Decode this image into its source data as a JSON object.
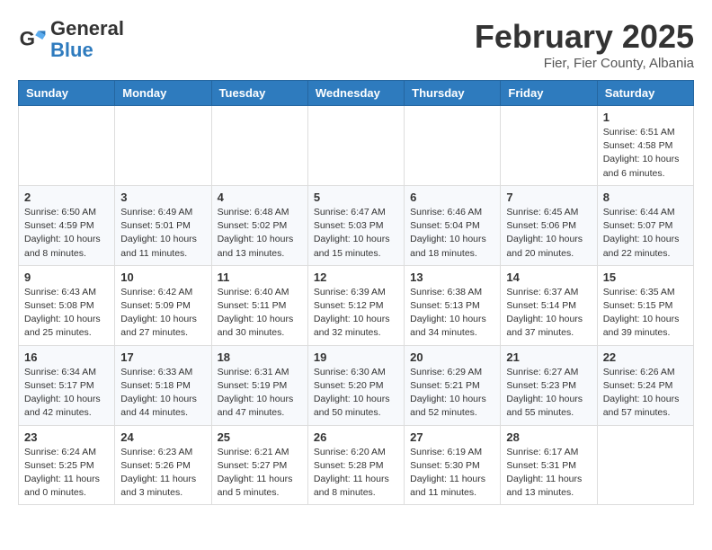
{
  "header": {
    "logo_general": "General",
    "logo_blue": "Blue",
    "month_year": "February 2025",
    "location": "Fier, Fier County, Albania"
  },
  "weekdays": [
    "Sunday",
    "Monday",
    "Tuesday",
    "Wednesday",
    "Thursday",
    "Friday",
    "Saturday"
  ],
  "weeks": [
    [
      {
        "day": "",
        "info": ""
      },
      {
        "day": "",
        "info": ""
      },
      {
        "day": "",
        "info": ""
      },
      {
        "day": "",
        "info": ""
      },
      {
        "day": "",
        "info": ""
      },
      {
        "day": "",
        "info": ""
      },
      {
        "day": "1",
        "info": "Sunrise: 6:51 AM\nSunset: 4:58 PM\nDaylight: 10 hours\nand 6 minutes."
      }
    ],
    [
      {
        "day": "2",
        "info": "Sunrise: 6:50 AM\nSunset: 4:59 PM\nDaylight: 10 hours\nand 8 minutes."
      },
      {
        "day": "3",
        "info": "Sunrise: 6:49 AM\nSunset: 5:01 PM\nDaylight: 10 hours\nand 11 minutes."
      },
      {
        "day": "4",
        "info": "Sunrise: 6:48 AM\nSunset: 5:02 PM\nDaylight: 10 hours\nand 13 minutes."
      },
      {
        "day": "5",
        "info": "Sunrise: 6:47 AM\nSunset: 5:03 PM\nDaylight: 10 hours\nand 15 minutes."
      },
      {
        "day": "6",
        "info": "Sunrise: 6:46 AM\nSunset: 5:04 PM\nDaylight: 10 hours\nand 18 minutes."
      },
      {
        "day": "7",
        "info": "Sunrise: 6:45 AM\nSunset: 5:06 PM\nDaylight: 10 hours\nand 20 minutes."
      },
      {
        "day": "8",
        "info": "Sunrise: 6:44 AM\nSunset: 5:07 PM\nDaylight: 10 hours\nand 22 minutes."
      }
    ],
    [
      {
        "day": "9",
        "info": "Sunrise: 6:43 AM\nSunset: 5:08 PM\nDaylight: 10 hours\nand 25 minutes."
      },
      {
        "day": "10",
        "info": "Sunrise: 6:42 AM\nSunset: 5:09 PM\nDaylight: 10 hours\nand 27 minutes."
      },
      {
        "day": "11",
        "info": "Sunrise: 6:40 AM\nSunset: 5:11 PM\nDaylight: 10 hours\nand 30 minutes."
      },
      {
        "day": "12",
        "info": "Sunrise: 6:39 AM\nSunset: 5:12 PM\nDaylight: 10 hours\nand 32 minutes."
      },
      {
        "day": "13",
        "info": "Sunrise: 6:38 AM\nSunset: 5:13 PM\nDaylight: 10 hours\nand 34 minutes."
      },
      {
        "day": "14",
        "info": "Sunrise: 6:37 AM\nSunset: 5:14 PM\nDaylight: 10 hours\nand 37 minutes."
      },
      {
        "day": "15",
        "info": "Sunrise: 6:35 AM\nSunset: 5:15 PM\nDaylight: 10 hours\nand 39 minutes."
      }
    ],
    [
      {
        "day": "16",
        "info": "Sunrise: 6:34 AM\nSunset: 5:17 PM\nDaylight: 10 hours\nand 42 minutes."
      },
      {
        "day": "17",
        "info": "Sunrise: 6:33 AM\nSunset: 5:18 PM\nDaylight: 10 hours\nand 44 minutes."
      },
      {
        "day": "18",
        "info": "Sunrise: 6:31 AM\nSunset: 5:19 PM\nDaylight: 10 hours\nand 47 minutes."
      },
      {
        "day": "19",
        "info": "Sunrise: 6:30 AM\nSunset: 5:20 PM\nDaylight: 10 hours\nand 50 minutes."
      },
      {
        "day": "20",
        "info": "Sunrise: 6:29 AM\nSunset: 5:21 PM\nDaylight: 10 hours\nand 52 minutes."
      },
      {
        "day": "21",
        "info": "Sunrise: 6:27 AM\nSunset: 5:23 PM\nDaylight: 10 hours\nand 55 minutes."
      },
      {
        "day": "22",
        "info": "Sunrise: 6:26 AM\nSunset: 5:24 PM\nDaylight: 10 hours\nand 57 minutes."
      }
    ],
    [
      {
        "day": "23",
        "info": "Sunrise: 6:24 AM\nSunset: 5:25 PM\nDaylight: 11 hours\nand 0 minutes."
      },
      {
        "day": "24",
        "info": "Sunrise: 6:23 AM\nSunset: 5:26 PM\nDaylight: 11 hours\nand 3 minutes."
      },
      {
        "day": "25",
        "info": "Sunrise: 6:21 AM\nSunset: 5:27 PM\nDaylight: 11 hours\nand 5 minutes."
      },
      {
        "day": "26",
        "info": "Sunrise: 6:20 AM\nSunset: 5:28 PM\nDaylight: 11 hours\nand 8 minutes."
      },
      {
        "day": "27",
        "info": "Sunrise: 6:19 AM\nSunset: 5:30 PM\nDaylight: 11 hours\nand 11 minutes."
      },
      {
        "day": "28",
        "info": "Sunrise: 6:17 AM\nSunset: 5:31 PM\nDaylight: 11 hours\nand 13 minutes."
      },
      {
        "day": "",
        "info": ""
      }
    ]
  ]
}
